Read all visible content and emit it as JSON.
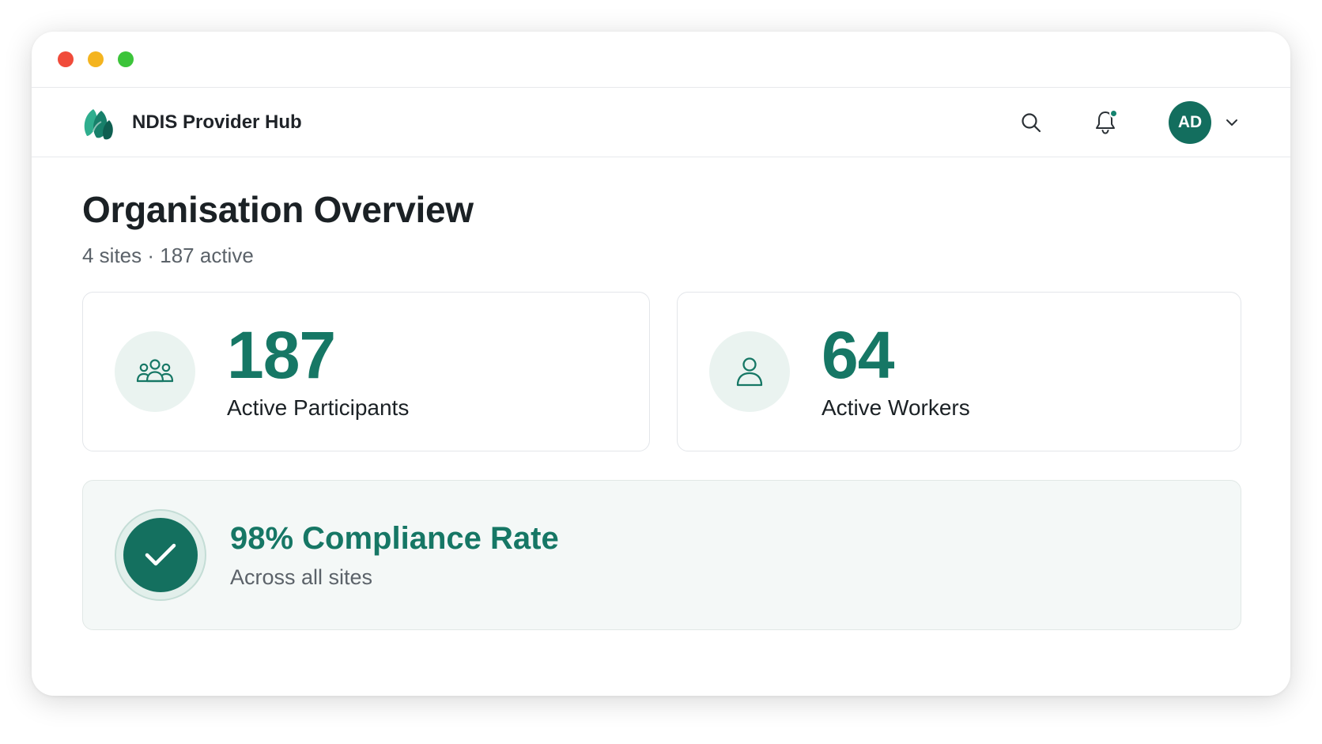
{
  "window": {
    "controls": [
      "close",
      "minimize",
      "maximize"
    ]
  },
  "app": {
    "name": "NDIS Provider Hub",
    "logo_icon": "leaf-logo-icon",
    "accent": "#167765"
  },
  "header": {
    "search_icon": "search-icon",
    "notifications_icon": "bell-icon",
    "has_unread_notifications": true,
    "user_initials": "AD",
    "menu_icon": "chevron-down-icon"
  },
  "page": {
    "title": "Organisation Overview",
    "subtitle": "4 sites · 187 active"
  },
  "stats": [
    {
      "icon": "users-group-icon",
      "value": "187",
      "label": "Active Participants"
    },
    {
      "icon": "user-icon",
      "value": "64",
      "label": "Active Workers"
    }
  ],
  "compliance": {
    "icon": "check-icon",
    "title": "98% Compliance Rate",
    "subtitle": "Across all sites"
  }
}
